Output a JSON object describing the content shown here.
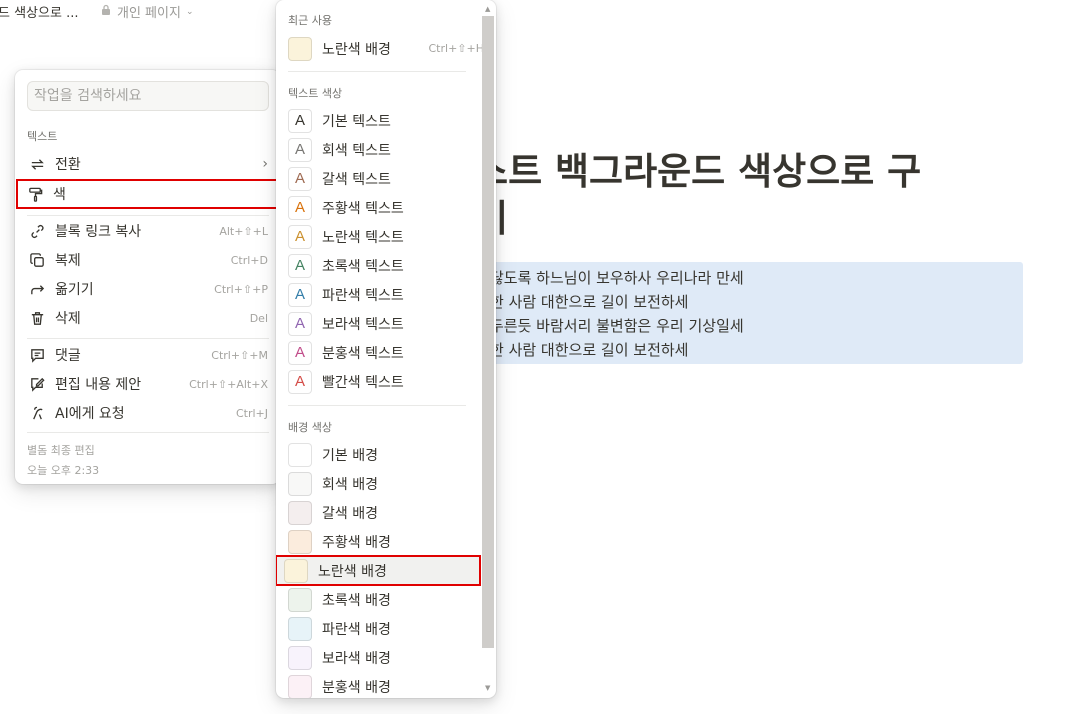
{
  "breadcrumb": {
    "page": "드 색상으로 ...",
    "private": "개인 페이지"
  },
  "page": {
    "title_line1": "텍스트 백그라운드 색상으로 구",
    "title_line2": "들기",
    "quote_lines": [
      "닳도록 하느님이 보우하사 우리나라 만세",
      "한 사람 대한으로 길이 보전하세",
      "두른듯 바람서리 불변함은 우리 기상일세",
      "한 사람 대한으로 길이 보전하세"
    ],
    "quote_bg": "#dfeaf7"
  },
  "context_menu": {
    "search_placeholder": "작업을 검색하세요",
    "section_text": "텍스트",
    "items": [
      {
        "label": "전환",
        "icon": "turn-into-icon",
        "submenu": true
      },
      {
        "label": "색",
        "icon": "paint-roller-icon",
        "submenu": true
      },
      {
        "label": "블록 링크 복사",
        "icon": "link-icon",
        "shortcut": "Alt+⇧+L"
      },
      {
        "label": "복제",
        "icon": "duplicate-icon",
        "shortcut": "Ctrl+D"
      },
      {
        "label": "옮기기",
        "icon": "move-arrow-icon",
        "shortcut": "Ctrl+⇧+P"
      },
      {
        "label": "삭제",
        "icon": "trash-icon",
        "shortcut": "Del"
      },
      {
        "label": "댓글",
        "icon": "comment-icon",
        "shortcut": "Ctrl+⇧+M"
      },
      {
        "label": "편집 내용 제안",
        "icon": "suggest-edit-icon",
        "shortcut": "Ctrl+⇧+Alt+X"
      },
      {
        "label": "AI에게 요청",
        "icon": "ai-icon",
        "shortcut": "Ctrl+J"
      }
    ],
    "footer_line1": "별돔 최종 편집",
    "footer_line2": "오늘 오후 2:33"
  },
  "color_menu": {
    "recent_label": "최근 사용",
    "recent_item": {
      "label": "노란색 배경",
      "shortcut": "Ctrl+⇧+H",
      "bg": "#fbf3db"
    },
    "text_label": "텍스트 색상",
    "text_colors": [
      {
        "label": "기본 텍스트",
        "color": "#37352f"
      },
      {
        "label": "회색 텍스트",
        "color": "#787774"
      },
      {
        "label": "갈색 텍스트",
        "color": "#9f6b53"
      },
      {
        "label": "주황색 텍스트",
        "color": "#d9730d"
      },
      {
        "label": "노란색 텍스트",
        "color": "#cb912f"
      },
      {
        "label": "초록색 텍스트",
        "color": "#448361"
      },
      {
        "label": "파란색 텍스트",
        "color": "#337ea9"
      },
      {
        "label": "보라색 텍스트",
        "color": "#9065b0"
      },
      {
        "label": "분홍색 텍스트",
        "color": "#c14c8a"
      },
      {
        "label": "빨간색 텍스트",
        "color": "#d44c47"
      }
    ],
    "bg_label": "배경 색상",
    "bg_colors": [
      {
        "label": "기본 배경",
        "bg": "#ffffff"
      },
      {
        "label": "회색 배경",
        "bg": "#f8f8f7"
      },
      {
        "label": "갈색 배경",
        "bg": "#f4eeee"
      },
      {
        "label": "주황색 배경",
        "bg": "#fbecdd"
      },
      {
        "label": "노란색 배경",
        "bg": "#fbf3db"
      },
      {
        "label": "초록색 배경",
        "bg": "#edf3ec"
      },
      {
        "label": "파란색 배경",
        "bg": "#e7f3f8"
      },
      {
        "label": "보라색 배경",
        "bg": "#f8f3fc"
      },
      {
        "label": "분홍색 배경",
        "bg": "#fcf1f6"
      }
    ],
    "swatch_letter": "A"
  },
  "colors": {
    "highlight_outline": "#e00000",
    "text": "#37352f",
    "muted": "#a5a4a0"
  }
}
